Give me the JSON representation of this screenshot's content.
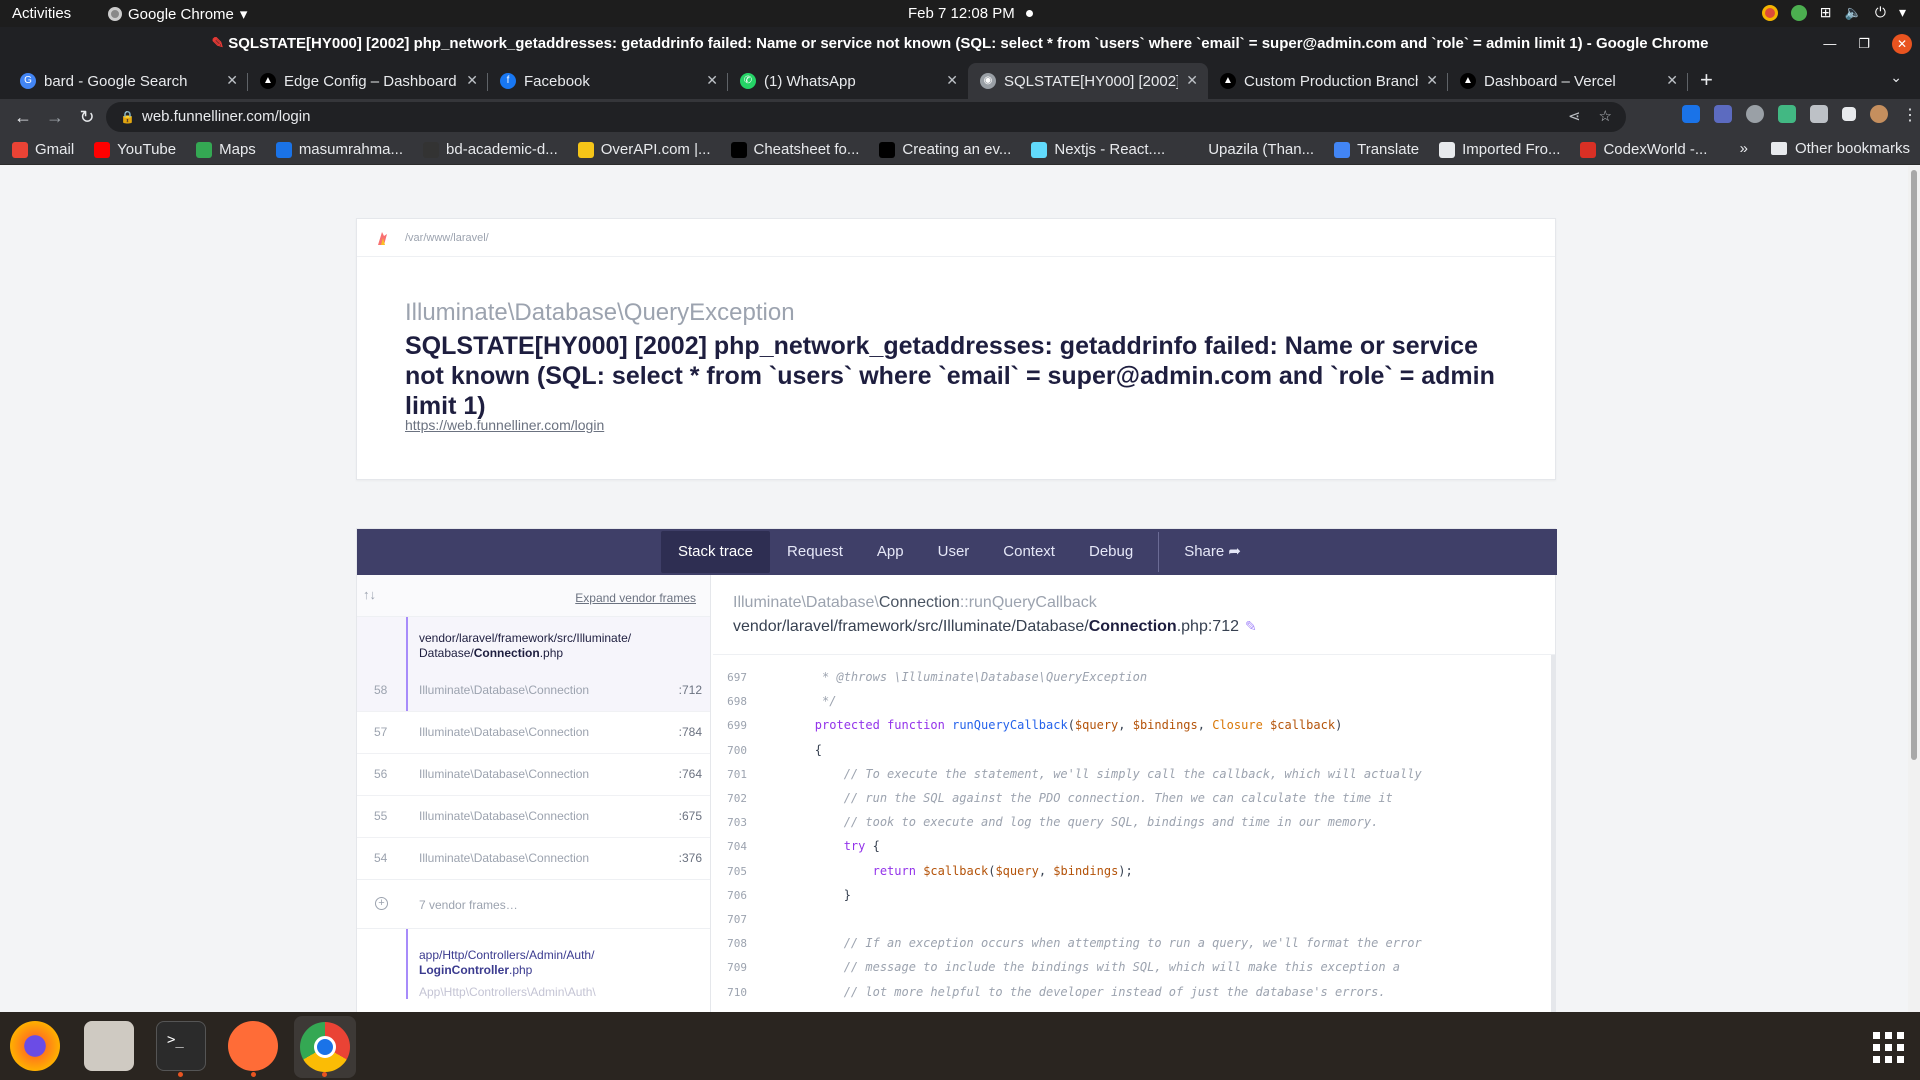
{
  "os": {
    "activities": "Activities",
    "app_name": "Google Chrome",
    "clock": "Feb 7  12:08 PM"
  },
  "window": {
    "title": "SQLSTATE[HY000] [2002] php_network_getaddresses: getaddrinfo failed: Name or service not known (SQL: select * from `users` where `email` = super@admin.com and `role` = admin limit 1) - Google Chrome"
  },
  "tabs": [
    {
      "title": "bard - Google Search",
      "color": "#4285f4",
      "glyph": "G"
    },
    {
      "title": "Edge Config – Dashboard",
      "color": "#000000",
      "glyph": "▲"
    },
    {
      "title": "Facebook",
      "color": "#1877f2",
      "glyph": "f"
    },
    {
      "title": "(1) WhatsApp",
      "color": "#25d366",
      "glyph": "✆"
    },
    {
      "title": "SQLSTATE[HY000] [2002]",
      "color": "#9aa0a6",
      "glyph": "◉"
    },
    {
      "title": "Custom Production Branch",
      "color": "#000000",
      "glyph": "▲"
    },
    {
      "title": "Dashboard – Vercel",
      "color": "#000000",
      "glyph": "▲"
    }
  ],
  "address": {
    "url": "web.funnelliner.com/login"
  },
  "bookmarks": [
    {
      "label": "Gmail",
      "color": "#ea4335"
    },
    {
      "label": "YouTube",
      "color": "#ff0000"
    },
    {
      "label": "Maps",
      "color": "#34a853"
    },
    {
      "label": "masumrahma...",
      "color": "#1a73e8"
    },
    {
      "label": "bd-academic-d...",
      "color": "#333333"
    },
    {
      "label": "OverAPI.com |...",
      "color": "#f5c518"
    },
    {
      "label": "Cheatsheet fo...",
      "color": "#000000"
    },
    {
      "label": "Creating an ev...",
      "color": "#000000"
    },
    {
      "label": "Nextjs - React....",
      "color": "#61dafb"
    },
    {
      "label": "Upazila (Than...",
      "color": "#35363a"
    },
    {
      "label": "Translate",
      "color": "#4285f4"
    },
    {
      "label": "Imported Fro...",
      "color": "#e8eaed"
    },
    {
      "label": "CodexWorld -...",
      "color": "#d93025"
    }
  ],
  "bookmarks_other": "Other bookmarks",
  "error": {
    "path": "/var/www/laravel/",
    "exception_class": "Illuminate\\Database\\QueryException",
    "message": "SQLSTATE[HY000] [2002] php_network_getaddresses: getaddrinfo failed: Name or service not known (SQL: select * from `users` where `email` = super@admin.com and `role` = admin limit 1)",
    "url": "https://web.funnelliner.com/login"
  },
  "stack_nav": [
    "Stack trace",
    "Request",
    "App",
    "User",
    "Context",
    "Debug"
  ],
  "share_label": "Share",
  "expand_vendor": "Expand vendor frames",
  "active_frame": {
    "path1": "vendor/laravel/framework/src/Illuminate/",
    "path2_dir": "Database/",
    "path2_file": "Connection",
    "path2_ext": ".php",
    "num": "58",
    "cls": "Illuminate\\Database\\Connection",
    "line": ":712"
  },
  "frames": [
    {
      "num": "57",
      "cls": "Illuminate\\Database\\Connection",
      "line": ":784"
    },
    {
      "num": "56",
      "cls": "Illuminate\\Database\\Connection",
      "line": ":764"
    },
    {
      "num": "55",
      "cls": "Illuminate\\Database\\Connection",
      "line": ":675"
    },
    {
      "num": "54",
      "cls": "Illuminate\\Database\\Connection",
      "line": ":376"
    }
  ],
  "vendor_frames": "7 vendor frames…",
  "app_frame": {
    "path1": "app/Http/Controllers/Admin/Auth/",
    "file": "LoginController",
    "ext": ".php",
    "next": "App\\Http\\Controllers\\Admin\\Auth\\"
  },
  "code_header": {
    "ns": "Illuminate\\Database\\",
    "cls": "Connection",
    "method": "::runQueryCallback",
    "file_dir": "vendor/laravel/framework/src/Illuminate/Database/",
    "file_name": "Connection",
    "file_ext": ".php:712"
  },
  "code_lines": [
    {
      "n": "697",
      "t": "         * @throws \\Illuminate\\Database\\QueryException"
    },
    {
      "n": "698",
      "t": "         */"
    },
    {
      "n": "699",
      "t": "        protected function runQueryCallback($query, $bindings, Closure $callback)"
    },
    {
      "n": "700",
      "t": "        {"
    },
    {
      "n": "701",
      "t": "            // To execute the statement, we'll simply call the callback, which will actually"
    },
    {
      "n": "702",
      "t": "            // run the SQL against the PDO connection. Then we can calculate the time it"
    },
    {
      "n": "703",
      "t": "            // took to execute and log the query SQL, bindings and time in our memory."
    },
    {
      "n": "704",
      "t": "            try {"
    },
    {
      "n": "705",
      "t": "                return $callback($query, $bindings);"
    },
    {
      "n": "706",
      "t": "            }"
    },
    {
      "n": "707",
      "t": ""
    },
    {
      "n": "708",
      "t": "            // If an exception occurs when attempting to run a query, we'll format the error"
    },
    {
      "n": "709",
      "t": "            // message to include the bindings with SQL, which will make this exception a"
    },
    {
      "n": "710",
      "t": "            // lot more helpful to the developer instead of just the database's errors."
    }
  ],
  "dock_apps": [
    "firefox-icon",
    "files-icon",
    "terminal-icon",
    "postman-icon",
    "chrome-icon"
  ]
}
